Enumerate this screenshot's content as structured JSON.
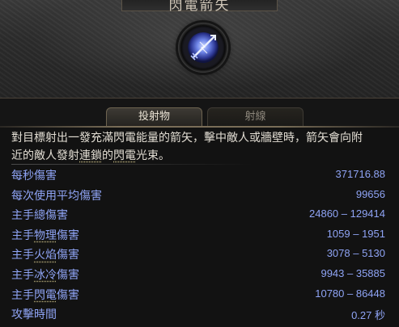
{
  "header": {
    "title": "閃電箭矢"
  },
  "skill_icon": "lightning-arrow-icon",
  "tabs": [
    {
      "label": "投射物",
      "active": true
    },
    {
      "label": "射線",
      "active": false
    }
  ],
  "description": {
    "line1": "對目標射出一發充滿閃電能量的箭矢，擊中敵人或牆壁時，箭矢會向附",
    "line2_a": "近的敵人發射",
    "line2_link1": "連鎖",
    "line2_b": "的",
    "line2_link2": "閃電",
    "line2_c": "光束。"
  },
  "stats": [
    {
      "label_a": "每秒傷害",
      "label_hl": "",
      "label_b": "",
      "value": "371716.88"
    },
    {
      "label_a": "每次使用平均傷害",
      "label_hl": "",
      "label_b": "",
      "value": "99656"
    },
    {
      "label_a": "主手總傷害",
      "label_hl": "",
      "label_b": "",
      "value": "24860 – 129414"
    },
    {
      "label_a": "主手",
      "label_hl": "物理",
      "label_b": "傷害",
      "value": "1059 – 1951"
    },
    {
      "label_a": "主手",
      "label_hl": "火焰",
      "label_b": "傷害",
      "value": "3078 – 5130"
    },
    {
      "label_a": "主手",
      "label_hl": "冰冷",
      "label_b": "傷害",
      "value": "9943 – 35885"
    },
    {
      "label_a": "主手",
      "label_hl": "閃電",
      "label_b": "傷害",
      "value": "10780 – 86448"
    },
    {
      "label_a": "攻擊時間",
      "label_hl": "",
      "label_b": "",
      "value": "0.27 秒"
    }
  ],
  "colors": {
    "stat_text": "#8fa4f5",
    "description_text": "#e2ddd3",
    "tab_border": "#6d6350"
  }
}
